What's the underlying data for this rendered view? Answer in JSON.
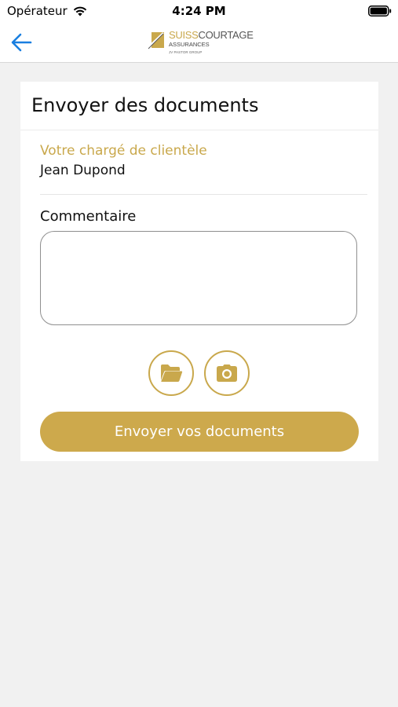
{
  "status_bar": {
    "carrier": "Opérateur",
    "time": "4:24 PM"
  },
  "header": {
    "logo": {
      "brand_part1": "SUISS",
      "brand_part2": "COURTAGE",
      "subtitle": "ASSURANCES",
      "group": "JV PASTOR GROUP"
    },
    "back_icon": "arrow-left-icon"
  },
  "card": {
    "title": "Envoyer des documents",
    "agent_label": "Votre chargé de clientèle",
    "agent_name": "Jean Dupond",
    "comment_label": "Commentaire",
    "comment_value": "",
    "attach_file_icon": "folder-open-icon",
    "take_photo_icon": "camera-icon",
    "submit_label": "Envoyer vos documents"
  },
  "colors": {
    "accent": "#c9a84c",
    "link_blue": "#1a7fe0",
    "background": "#f1f1f1"
  }
}
